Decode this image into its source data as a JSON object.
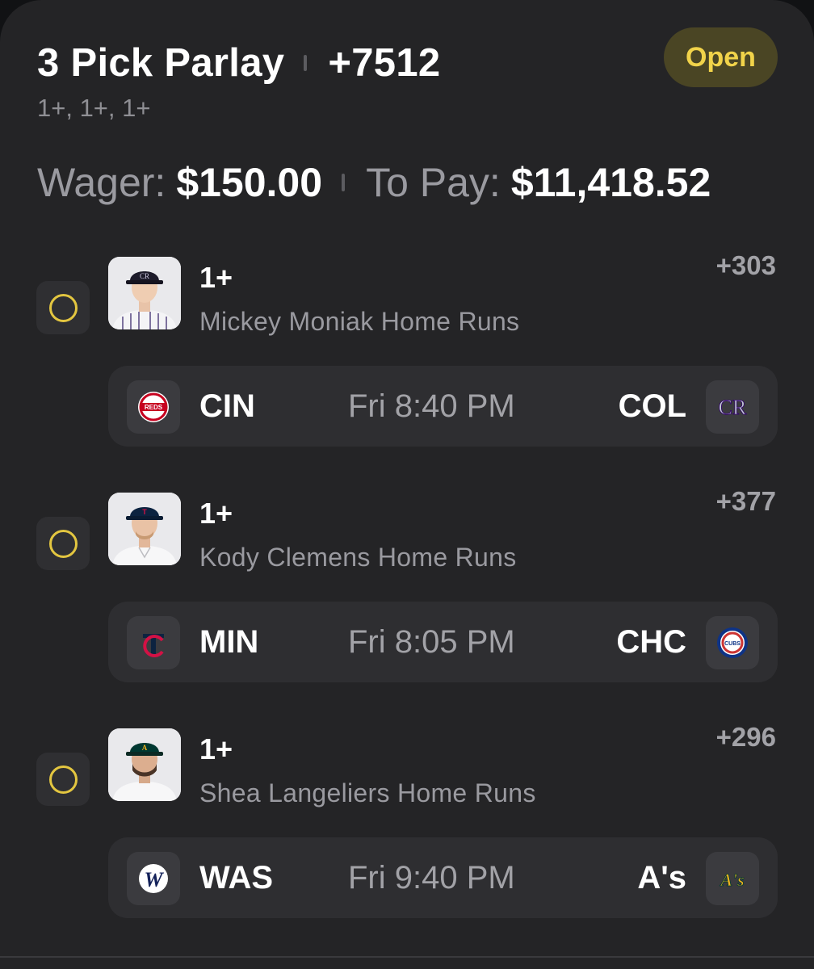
{
  "header": {
    "title": "3 Pick Parlay",
    "odds": "+7512",
    "subtitle": "1+, 1+, 1+",
    "status": "Open"
  },
  "wager": {
    "wager_label": "Wager:",
    "wager_value": "$150.00",
    "payout_label": "To Pay:",
    "payout_value": "$11,418.52"
  },
  "picks": [
    {
      "line": "1+",
      "market": "Mickey Moniak Home Runs",
      "odds": "+303",
      "headshot_icon": "player-headshot-rockies",
      "game": {
        "away": "CIN",
        "away_icon": "reds-logo-icon",
        "time": "Fri 8:40 PM",
        "home": "COL",
        "home_icon": "rockies-logo-icon"
      }
    },
    {
      "line": "1+",
      "market": "Kody Clemens Home Runs",
      "odds": "+377",
      "headshot_icon": "player-headshot-twins",
      "game": {
        "away": "MIN",
        "away_icon": "twins-logo-icon",
        "time": "Fri 8:05 PM",
        "home": "CHC",
        "home_icon": "cubs-logo-icon"
      }
    },
    {
      "line": "1+",
      "market": "Shea Langeliers Home Runs",
      "odds": "+296",
      "headshot_icon": "player-headshot-athletics",
      "game": {
        "away": "WAS",
        "away_icon": "nationals-logo-icon",
        "time": "Fri 9:40 PM",
        "home": "A's",
        "home_icon": "athletics-logo-icon"
      }
    }
  ],
  "colors": {
    "card_bg": "#242426",
    "status_bg": "#4a4524",
    "status_text": "#f1d34a",
    "radio_ring": "#e3c640",
    "muted_text": "#9a9aa0"
  },
  "logo_text": {
    "reds": "REDS",
    "rockies": "CR",
    "cubs": "CUBS",
    "twins": "TC",
    "nationals": "W",
    "athletics": "A's"
  }
}
